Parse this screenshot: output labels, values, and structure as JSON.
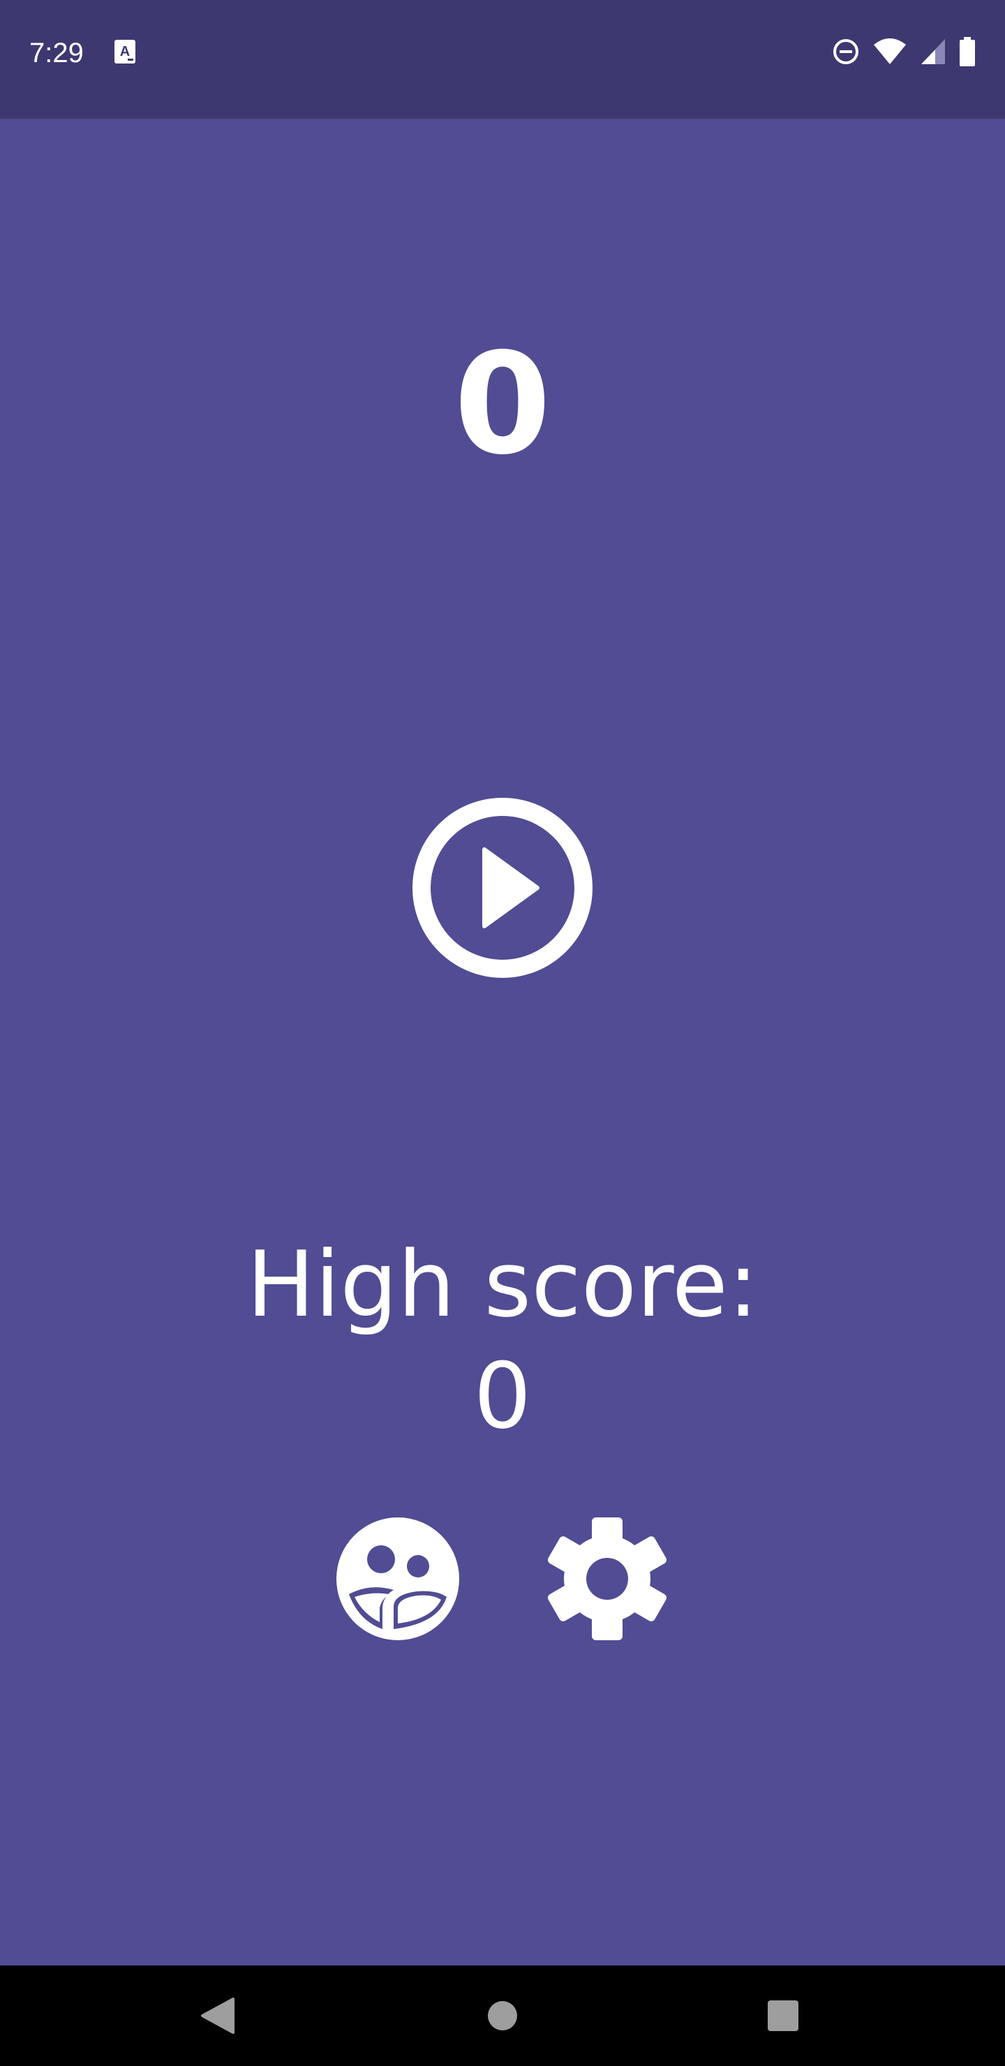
{
  "status_bar": {
    "time": "7:29",
    "icons": [
      "text-format-notification-icon",
      "do-not-disturb-icon",
      "wifi-icon",
      "cellular-signal-icon",
      "battery-icon"
    ]
  },
  "game": {
    "score": "0",
    "high_score_label": "High score:",
    "high_score_value": "0"
  },
  "controls": [
    "play-icon",
    "leaderboard-icon",
    "settings-gear-icon"
  ],
  "nav_bar": [
    "back-icon",
    "home-icon",
    "recents-icon"
  ],
  "colors": {
    "background": "#514c93",
    "status_bar": "#3d3870",
    "foreground": "#ffffff",
    "nav_bar": "#000000"
  }
}
